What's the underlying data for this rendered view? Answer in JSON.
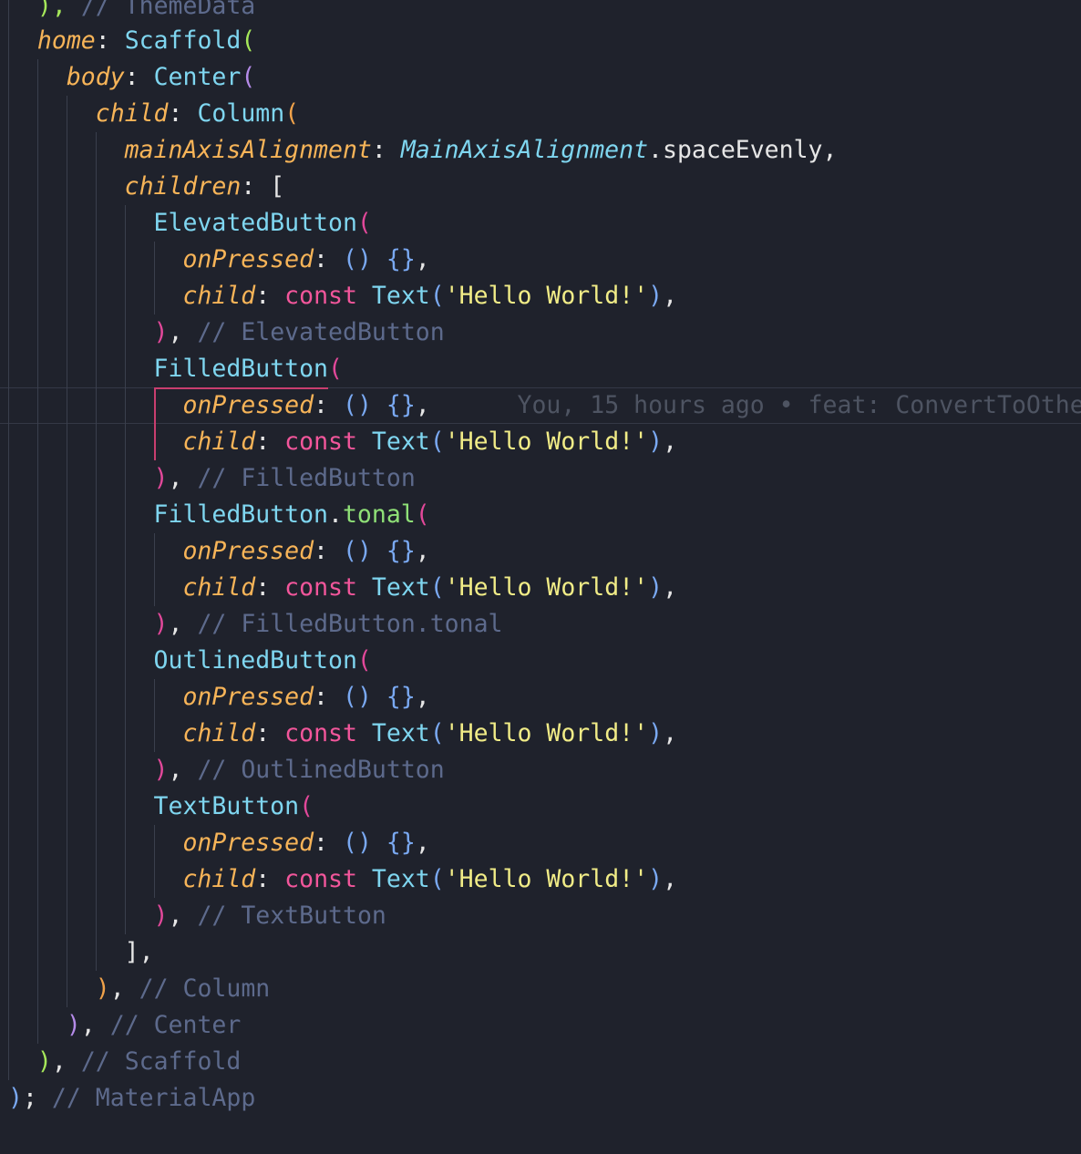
{
  "editor": {
    "language": "dart",
    "theme_colors": {
      "background": "#1f222c",
      "property": "#f7b458",
      "class": "#7fd6f0",
      "keyword": "#f2569b",
      "string": "#f1ec87",
      "method": "#8fe077",
      "comment": "#5d6a8c",
      "blame": "#4e5462"
    },
    "lines": {
      "l00": {
        "close": "),",
        "comment": "// ThemeData"
      },
      "l01": {
        "prop": "home",
        "colon": ":",
        "cls": "Scaffold",
        "paren": "("
      },
      "l02": {
        "prop": "body",
        "colon": ":",
        "cls": "Center",
        "paren": "("
      },
      "l03": {
        "prop": "child",
        "colon": ":",
        "cls": "Column",
        "paren": "("
      },
      "l04": {
        "prop": "mainAxisAlignment",
        "colon": ":",
        "enum": "MainAxisAlignment",
        "member": ".spaceEvenly,"
      },
      "l05": {
        "prop": "children",
        "colon": ":",
        "bracket": "["
      },
      "l06": {
        "cls": "ElevatedButton",
        "paren": "("
      },
      "l07": {
        "prop": "onPressed",
        "colon": ":",
        "parens": "()",
        "braces": "{}",
        "comma": ","
      },
      "l08": {
        "prop": "child",
        "colon": ":",
        "kw": "const",
        "cls": "Text",
        "open": "(",
        "str": "'Hello World!'",
        "close": ")",
        "comma": ","
      },
      "l09": {
        "close": ")",
        "comma": ",",
        "comment": "// ElevatedButton"
      },
      "l10": {
        "cls": "FilledButton",
        "paren": "("
      },
      "l11": {
        "prop": "onPressed",
        "colon": ":",
        "parens": "()",
        "braces": "{}",
        "comma": ",",
        "blame": "You, 15 hours ago • feat: ConvertToOthe"
      },
      "l12": {
        "prop": "child",
        "colon": ":",
        "kw": "const",
        "cls": "Text",
        "open": "(",
        "str": "'Hello World!'",
        "close": ")",
        "comma": ","
      },
      "l13": {
        "close": ")",
        "comma": ",",
        "comment": "// FilledButton"
      },
      "l14": {
        "cls": "FilledButton",
        "dot": ".",
        "method": "tonal",
        "paren": "("
      },
      "l15": {
        "prop": "onPressed",
        "colon": ":",
        "parens": "()",
        "braces": "{}",
        "comma": ","
      },
      "l16": {
        "prop": "child",
        "colon": ":",
        "kw": "const",
        "cls": "Text",
        "open": "(",
        "str": "'Hello World!'",
        "close": ")",
        "comma": ","
      },
      "l17": {
        "close": ")",
        "comma": ",",
        "comment": "// FilledButton.tonal"
      },
      "l18": {
        "cls": "OutlinedButton",
        "paren": "("
      },
      "l19": {
        "prop": "onPressed",
        "colon": ":",
        "parens": "()",
        "braces": "{}",
        "comma": ","
      },
      "l20": {
        "prop": "child",
        "colon": ":",
        "kw": "const",
        "cls": "Text",
        "open": "(",
        "str": "'Hello World!'",
        "close": ")",
        "comma": ","
      },
      "l21": {
        "close": ")",
        "comma": ",",
        "comment": "// OutlinedButton"
      },
      "l22": {
        "cls": "TextButton",
        "paren": "("
      },
      "l23": {
        "prop": "onPressed",
        "colon": ":",
        "parens": "()",
        "braces": "{}",
        "comma": ","
      },
      "l24": {
        "prop": "child",
        "colon": ":",
        "kw": "const",
        "cls": "Text",
        "open": "(",
        "str": "'Hello World!'",
        "close": ")",
        "comma": ","
      },
      "l25": {
        "close": ")",
        "comma": ",",
        "comment": "// TextButton"
      },
      "l26": {
        "close": "],"
      },
      "l27": {
        "close": ")",
        "comma": ",",
        "comment": "// Column"
      },
      "l28": {
        "close": ")",
        "comma": ",",
        "comment": "// Center"
      },
      "l29": {
        "close": ")",
        "comma": ",",
        "comment": "// Scaffold"
      },
      "l30": {
        "close": ")",
        "semi": ";",
        "comment": "// MaterialApp"
      }
    }
  }
}
